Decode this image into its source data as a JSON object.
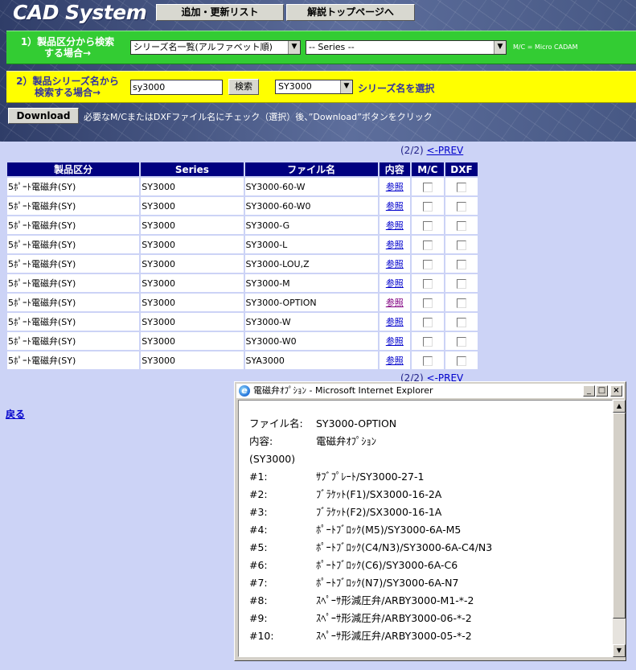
{
  "header": {
    "logo": "CAD System",
    "buttons": {
      "update_list": "追加・更新リスト",
      "top_page": "解説トップページへ"
    }
  },
  "search1": {
    "label_line1": "1）製品区分から検索",
    "label_line2": "する場合→",
    "select1": "シリーズ名一覧(アルファベット順)",
    "select2": "-- Series --",
    "note": "M/C = Micro CADAM"
  },
  "search2": {
    "label_line1": "2）製品シリーズ名から",
    "label_line2": "検索する場合→",
    "input_value": "sy3000",
    "search_button": "検索",
    "series_select": "SY3000",
    "series_note": "シリーズ名を選択"
  },
  "download": {
    "button": "Download",
    "note": "必要なM/CまたはDXFファイル名にチェック（選択）後、”Download”ボタンをクリック"
  },
  "pager": {
    "page": "(2/2)",
    "prev": "<-PREV"
  },
  "table": {
    "headers": [
      "製品区分",
      "Series",
      "ファイル名",
      "内容",
      "M/C",
      "DXF"
    ],
    "rows": [
      {
        "category": "5ﾎﾟｰﾄ電磁弁(SY)",
        "series": "SY3000",
        "file": "SY3000-60-W",
        "link": "参照"
      },
      {
        "category": "5ﾎﾟｰﾄ電磁弁(SY)",
        "series": "SY3000",
        "file": "SY3000-60-W0",
        "link": "参照"
      },
      {
        "category": "5ﾎﾟｰﾄ電磁弁(SY)",
        "series": "SY3000",
        "file": "SY3000-G",
        "link": "参照"
      },
      {
        "category": "5ﾎﾟｰﾄ電磁弁(SY)",
        "series": "SY3000",
        "file": "SY3000-L",
        "link": "参照"
      },
      {
        "category": "5ﾎﾟｰﾄ電磁弁(SY)",
        "series": "SY3000",
        "file": "SY3000-LOU,Z",
        "link": "参照"
      },
      {
        "category": "5ﾎﾟｰﾄ電磁弁(SY)",
        "series": "SY3000",
        "file": "SY3000-M",
        "link": "参照"
      },
      {
        "category": "5ﾎﾟｰﾄ電磁弁(SY)",
        "series": "SY3000",
        "file": "SY3000-OPTION",
        "link": "参照"
      },
      {
        "category": "5ﾎﾟｰﾄ電磁弁(SY)",
        "series": "SY3000",
        "file": "SY3000-W",
        "link": "参照"
      },
      {
        "category": "5ﾎﾟｰﾄ電磁弁(SY)",
        "series": "SY3000",
        "file": "SY3000-W0",
        "link": "参照"
      },
      {
        "category": "5ﾎﾟｰﾄ電磁弁(SY)",
        "series": "SY3000",
        "file": "SYA3000",
        "link": "参照"
      }
    ]
  },
  "back_link": "戻る",
  "popup": {
    "title": "電磁弁ｵﾌﾟｼｮﾝ - Microsoft Internet Explorer",
    "file_label": "ファイル名:",
    "file_value": "SY3000-OPTION",
    "content_label": "内容:",
    "content_value": "電磁弁ｵﾌﾟｼｮﾝ",
    "series_line": "(SY3000)",
    "items": [
      {
        "num": "#1:",
        "text": "ｻﾌﾞﾌﾟﾚｰﾄ/SY3000-27-1"
      },
      {
        "num": "#2:",
        "text": "ﾌﾞﾗｹｯﾄ(F1)/SX3000-16-2A"
      },
      {
        "num": "#3:",
        "text": "ﾌﾞﾗｹｯﾄ(F2)/SX3000-16-1A"
      },
      {
        "num": "#4:",
        "text": "ﾎﾟｰﾄﾌﾞﾛｯｸ(M5)/SY3000-6A-M5"
      },
      {
        "num": "#5:",
        "text": "ﾎﾟｰﾄﾌﾞﾛｯｸ(C4/N3)/SY3000-6A-C4/N3"
      },
      {
        "num": "#6:",
        "text": "ﾎﾟｰﾄﾌﾞﾛｯｸ(C6)/SY3000-6A-C6"
      },
      {
        "num": "#7:",
        "text": "ﾎﾟｰﾄﾌﾞﾛｯｸ(N7)/SY3000-6A-N7"
      },
      {
        "num": "#8:",
        "text": "ｽﾍﾟｰｻ形減圧弁/ARBY3000-M1-*-2"
      },
      {
        "num": "#9:",
        "text": "ｽﾍﾟｰｻ形減圧弁/ARBY3000-06-*-2"
      },
      {
        "num": "#10:",
        "text": "ｽﾍﾟｰｻ形減圧弁/ARBY3000-05-*-2"
      }
    ]
  }
}
